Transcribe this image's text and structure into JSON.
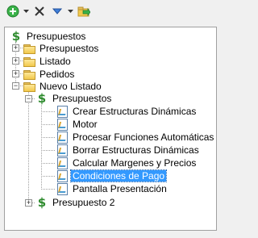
{
  "toolbar": {
    "buttons": [
      {
        "name": "add-button",
        "icon": "green-plus-circle-icon"
      },
      {
        "name": "add-dropdown",
        "icon": "dropdown-arrow-icon"
      },
      {
        "name": "delete-button",
        "icon": "x-icon"
      },
      {
        "name": "move-down-button",
        "icon": "blue-arrow-down-icon"
      },
      {
        "name": "move-dropdown",
        "icon": "dropdown-arrow-icon"
      },
      {
        "name": "export-button",
        "icon": "folder-arrow-icon"
      }
    ]
  },
  "tree": {
    "root": "Presupuestos",
    "level1": [
      "Presupuestos",
      "Listado",
      "Pedidos",
      "Nuevo Listado"
    ],
    "nuevo_listado_child": "Presupuestos",
    "items": [
      "Crear Estructuras Dinámicas",
      "Motor",
      "Procesar Funciones Automáticas",
      "Borrar Estructuras Dinámicas",
      "Calcular Margenes y Precios",
      "Condiciones de Pago",
      "Pantalla Presentación"
    ],
    "selected": "Condiciones de Pago",
    "sibling": "Presupuesto 2"
  },
  "colors": {
    "selection": "#3399ff",
    "dollar_icon": "#2e8b2e",
    "folder": "#f2c94c"
  }
}
